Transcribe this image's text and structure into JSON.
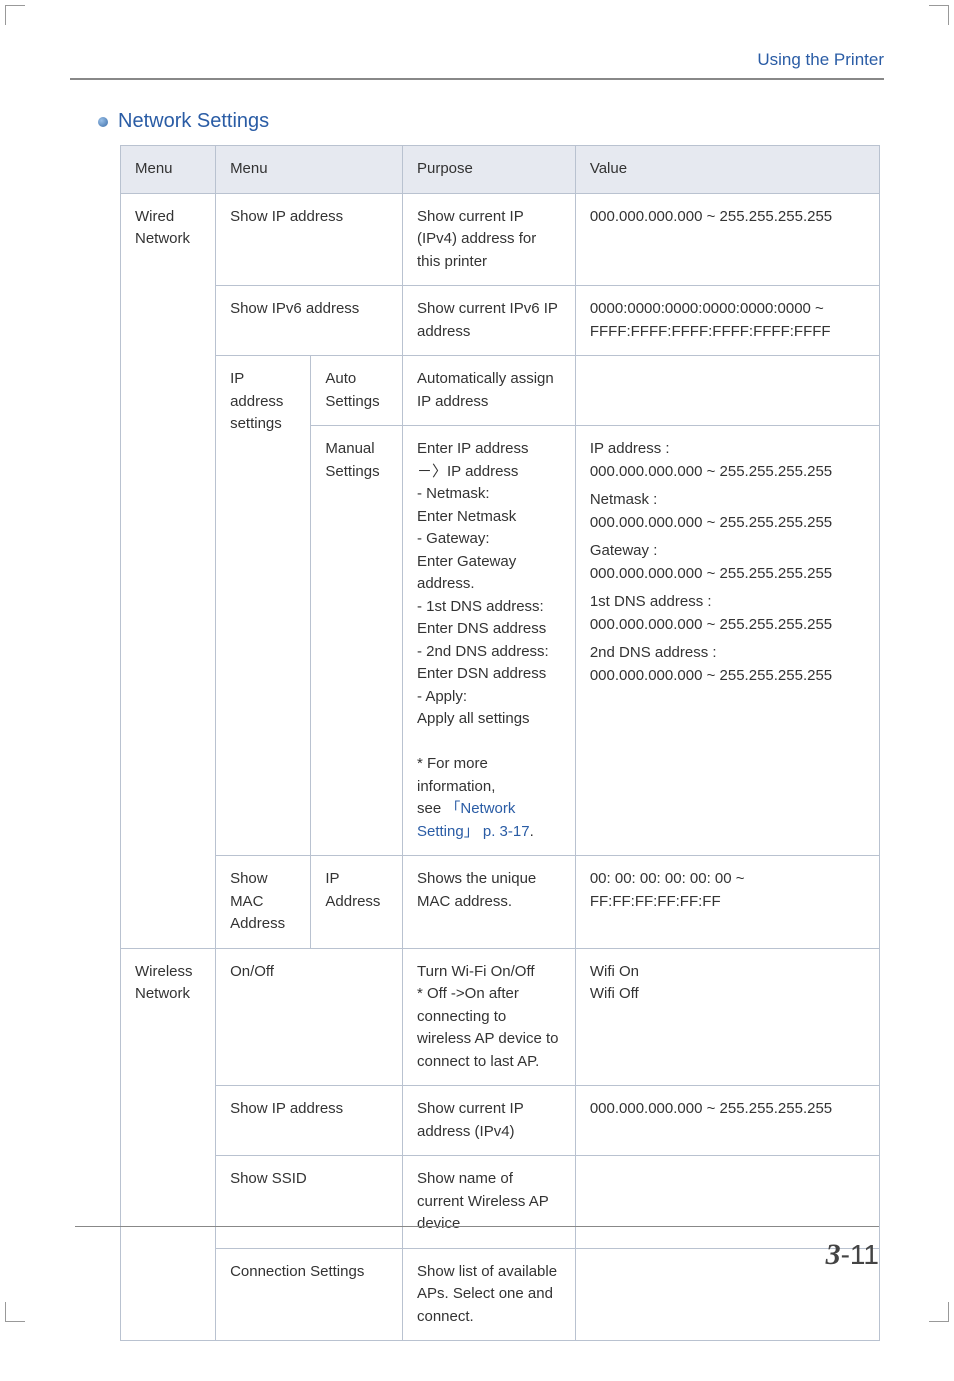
{
  "header": {
    "breadcrumb": "Using the Printer"
  },
  "section": {
    "title": "Network Settings"
  },
  "table": {
    "headers": {
      "menu1": "Menu",
      "menu2": "Menu",
      "purpose": "Purpose",
      "value": "Value"
    },
    "wired": {
      "title": "Wired Network",
      "row_show_ip": {
        "menu": "Show IP address",
        "purpose": "Show current IP (IPv4) address for this printer",
        "value": "000.000.000.000 ~ 255.255.255.255"
      },
      "row_show_ipv6": {
        "menu": "Show IPv6 address",
        "purpose": "Show current IPv6 IP address",
        "value": "0000:0000:0000:0000:0000:0000 ~ FFFF:FFFF:FFFF:FFFF:FFFF:FFFF"
      },
      "ip_settings_label": "IP address settings",
      "row_auto": {
        "sub": "Auto Settings",
        "purpose": "Automatically assign IP address",
        "value": ""
      },
      "row_manual": {
        "sub": "Manual Settings",
        "purpose_lines": [
          "Enter IP address",
          "－〉IP address",
          "- Netmask:",
          "Enter Netmask",
          "- Gateway:",
          "Enter Gateway address.",
          "- 1st DNS address:",
          "Enter DNS address",
          "- 2nd DNS address:",
          "Enter DSN address",
          "- Apply:",
          "Apply all settings",
          "",
          "* For more information,"
        ],
        "purpose_link_prefix": "see ",
        "purpose_link": "「Network Setting」 p. 3-17",
        "purpose_link_suffix": ".",
        "value_lines": [
          "IP address :",
          "000.000.000.000 ~ 255.255.255.255",
          "Netmask :",
          "000.000.000.000 ~ 255.255.255.255",
          "Gateway :",
          "000.000.000.000 ~ 255.255.255.255",
          "1st DNS address :",
          "000.000.000.000 ~ 255.255.255.255",
          "2nd DNS address :",
          "000.000.000.000 ~ 255.255.255.255"
        ]
      },
      "row_mac": {
        "menu": "Show MAC Address",
        "sub": "IP Address",
        "purpose": "Shows the unique MAC address.",
        "value": "00: 00: 00: 00: 00: 00 ~ FF:FF:FF:FF:FF:FF"
      }
    },
    "wireless": {
      "title": "Wireless Network",
      "row_onoff": {
        "menu": "On/Off",
        "purpose": "Turn Wi-Fi On/Off\n* Off ->On after connecting to wireless AP device to connect to last AP.",
        "value": " Wifi On\n Wifi Off"
      },
      "row_show_ip": {
        "menu": "Show IP address",
        "purpose": "Show current IP address (IPv4)",
        "value": "000.000.000.000 ~ 255.255.255.255"
      },
      "row_ssid": {
        "menu": "Show SSID",
        "purpose": "Show name of current Wireless AP device",
        "value": ""
      },
      "row_conn": {
        "menu": "Connection Settings",
        "purpose": "Show list of available APs. Select one and connect.",
        "value": ""
      }
    }
  },
  "footer": {
    "chapter": "3",
    "page": "-11"
  }
}
